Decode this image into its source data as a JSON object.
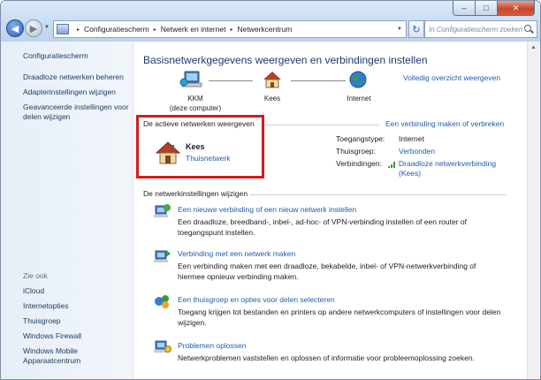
{
  "window": {
    "caption": {
      "minimize": "–",
      "maximize": "□",
      "close": "✕"
    },
    "nav": {
      "back": "◀",
      "forward": "▶",
      "dropdown": "▼"
    },
    "breadcrumb": [
      "Configuratiescherm",
      "Netwerk en internet",
      "Netwerkcentrum"
    ],
    "breadcrumb_sep": "▸",
    "search_placeholder": "In Configuratiescherm zoeken"
  },
  "sidebar": {
    "links": [
      "Configuratiescherm",
      "Draadloze netwerken beheren",
      "Adapterinstellingen wijzigen",
      "Geavanceerde instellingen voor delen wijzigen"
    ],
    "see_also_heading": "Zie ook",
    "see_also": [
      "iCloud",
      "Internetopties",
      "Thuisgroep",
      "Windows Firewall",
      "Windows Mobile Apparaatcentrum"
    ]
  },
  "main": {
    "title": "Basisnetwerkgegevens weergeven en verbindingen instellen",
    "full_map_link": "Volledig overzicht weergeven",
    "map": {
      "computer_name": "KKM",
      "computer_sub": "(deze computer)",
      "network_name": "Kees",
      "internet_label": "Internet"
    },
    "active": {
      "heading": "De actieve netwerken weergeven",
      "connect_link": "Een verbinding maken of verbreken",
      "network_name": "Kees",
      "network_type": "Thuisnetwerk",
      "access_label": "Toegangstype:",
      "access_value": "Internet",
      "homegroup_label": "Thuisgroep:",
      "homegroup_value": "Verbonden",
      "connections_label": "Verbindingen:",
      "connections_value": "Draadloze netwerkverbinding (Kees)"
    },
    "change": {
      "heading": "De netwerkinstellingen wijzigen",
      "tasks": [
        {
          "link": "Een nieuwe verbinding of een nieuw netwerk instellen",
          "desc": "Een draadloze, breedband-, inbel-, ad-hoc- of VPN-verbinding instellen of een router of toegangspunt instellen."
        },
        {
          "link": "Verbinding met een netwerk maken",
          "desc": "Een verbinding maken met een draadloze, bekabelde, inbel- of VPN-netwerkverbinding of hiermee opnieuw verbinding maken."
        },
        {
          "link": "Een thuisgroep en opties voor delen selecteren",
          "desc": "Toegang krijgen tot bestanden en printers op andere netwerkcomputers of instellingen voor delen wijzigen."
        },
        {
          "link": "Problemen oplossen",
          "desc": "Netwerkproblemen vaststellen en oplossen of informatie voor probleemoplossing zoeken."
        }
      ]
    }
  },
  "colors": {
    "link": "#1e5cb3",
    "highlight": "#d41c1c",
    "title": "#1c3a6f"
  },
  "icons": [
    "back-arrow-icon",
    "forward-arrow-icon",
    "refresh-icon",
    "search-icon",
    "computer-icon",
    "house-icon",
    "globe-icon",
    "signal-bars-icon",
    "shield-icon"
  ]
}
